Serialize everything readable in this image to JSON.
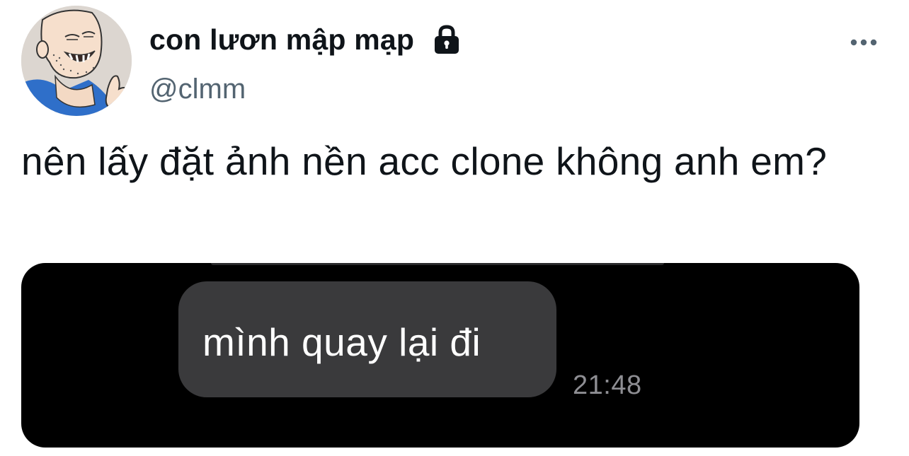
{
  "tweet": {
    "author": {
      "display_name": "con lươn mập mạp",
      "handle": "@clmm",
      "avatar_icon": "cartoon-man-avatar",
      "protected_icon": "lock-icon"
    },
    "more_icon": "more-dots-icon",
    "text": "nên lấy đặt ảnh nền acc clone không anh em?",
    "media": {
      "type": "chat-screenshot",
      "message_bubble_text": "mình quay lại đi",
      "message_time": "21:48",
      "bubble_color": "#3a3a3c",
      "background_color": "#000000"
    }
  },
  "colors": {
    "primary_text": "#0f1419",
    "secondary_text": "#536471",
    "background": "#ffffff"
  }
}
